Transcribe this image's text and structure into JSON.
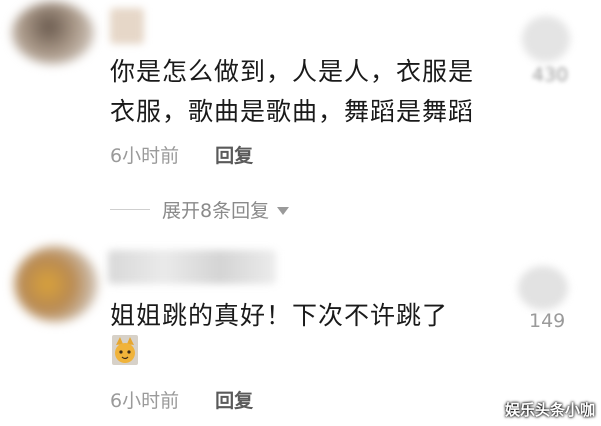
{
  "comments": [
    {
      "lines": [
        "你是怎么做到，人是人，衣服是",
        "衣服，歌曲是歌曲，舞蹈是舞蹈"
      ],
      "time": "6小时前",
      "reply": "回复",
      "likes": "430"
    },
    {
      "lines": [
        "姐姐跳的真好！下次不许跳了"
      ],
      "emoji": "cat-face-icon",
      "time": "6小时前",
      "reply": "回复",
      "likes": "149"
    }
  ],
  "expand": {
    "label": "展开8条回复",
    "icon": "chevron-down-icon"
  },
  "watermark": "娱乐头条小咖",
  "colors": {
    "text": "#1a1a1a",
    "meta": "#9a9a9a",
    "reply": "#5a5a5a"
  }
}
